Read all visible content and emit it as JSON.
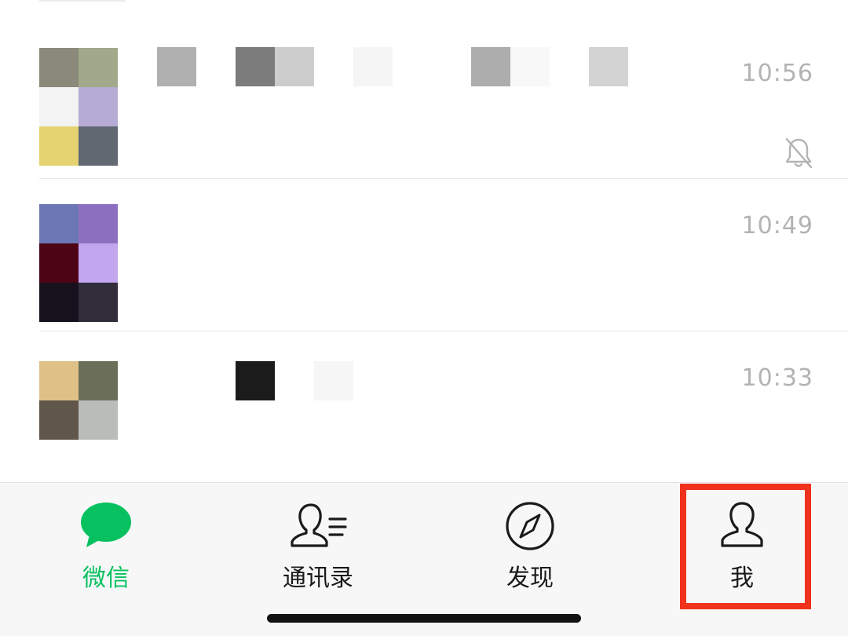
{
  "chats": [
    {
      "time": "10:56",
      "muted": true,
      "avatar_colors": [
        "#8b8979",
        "#a0a989",
        "#f3f3f3",
        "#b6abd4",
        "#e5d372",
        "#616872"
      ],
      "name_blocks": [
        "#b0b0b0",
        "#7c7c7c",
        "#cdcdcd",
        "#f5f5f5",
        "#adadad",
        "#f8f8f8",
        "#d3d3d3"
      ]
    },
    {
      "time": "10:49",
      "muted": false,
      "avatar_colors": [
        "#6c77b5",
        "#8d6fc0",
        "#4d0516",
        "#c2a6ee",
        "#17111e",
        "#312d3b"
      ],
      "name_blocks": []
    },
    {
      "time": "10:33",
      "muted": false,
      "avatar_colors": [
        "#dfc187",
        "#6b6f57",
        "#60564b",
        "#b9bcb8"
      ],
      "name_blocks": [
        "#1b1b1b",
        "#f6f6f6"
      ]
    }
  ],
  "tabs": [
    {
      "label": "微信",
      "icon": "chat-bubble-icon",
      "active": true
    },
    {
      "label": "通讯录",
      "icon": "contacts-icon",
      "active": false
    },
    {
      "label": "发现",
      "icon": "compass-icon",
      "active": false
    },
    {
      "label": "我",
      "icon": "person-icon",
      "active": false
    }
  ],
  "colors": {
    "accent": "#07c160",
    "highlight": "#f0321c",
    "time_text": "#b3b3b3"
  }
}
